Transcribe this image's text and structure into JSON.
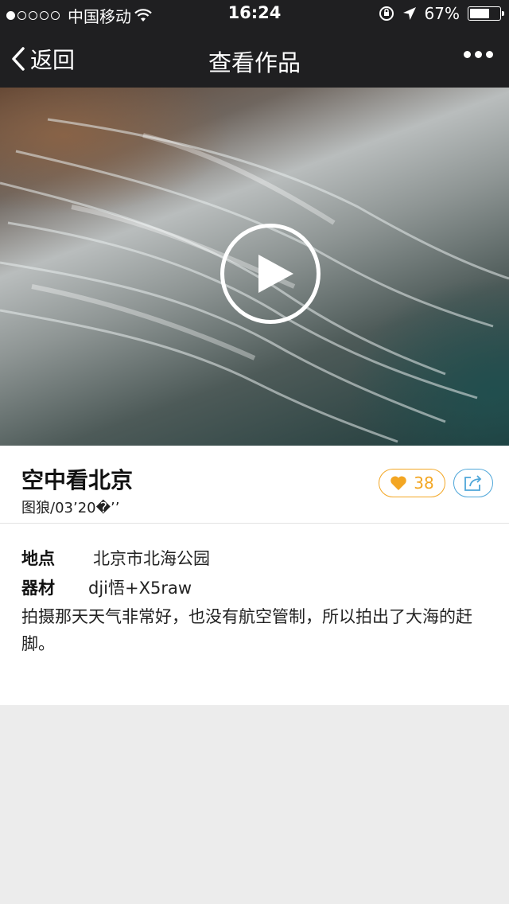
{
  "status_bar": {
    "carrier": "中国移动",
    "time": "16:24",
    "battery": "67%",
    "battery_level": 0.67
  },
  "nav": {
    "back_label": "返回",
    "title": "查看作品"
  },
  "work": {
    "title": "空中看北京",
    "meta": "图狼/03’20�’’",
    "likes": "38",
    "location_label": "地点",
    "location_value": "北京市北海公园",
    "equipment_label": "器材",
    "equipment_value": "dji悟+X5raw",
    "description": "拍摄那天天气非常好，也没有航空管制，所以拍出了大海的赶脚。"
  },
  "colors": {
    "like": "#f3a623",
    "share": "#4ea6d9",
    "bar": "#1f1f21"
  }
}
